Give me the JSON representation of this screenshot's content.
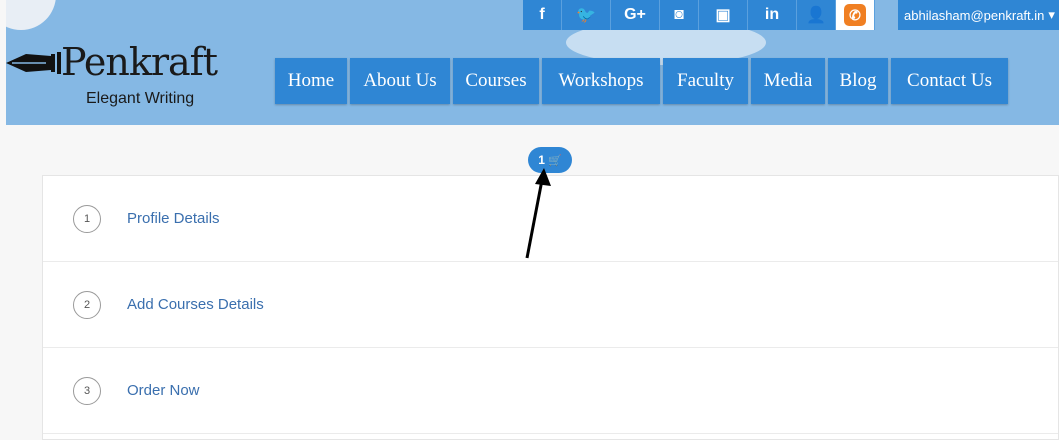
{
  "brand": {
    "name": "Penkraft",
    "tagline": "Elegant Writing"
  },
  "social": {
    "items": [
      {
        "name": "facebook-icon",
        "glyph": "f"
      },
      {
        "name": "twitter-icon",
        "glyph": "🐦"
      },
      {
        "name": "google-plus-icon",
        "glyph": "G+"
      },
      {
        "name": "instagram-icon",
        "glyph": "◙"
      },
      {
        "name": "youtube-icon",
        "glyph": "▣"
      },
      {
        "name": "linkedin-icon",
        "glyph": "in"
      },
      {
        "name": "user-icon",
        "glyph": "👤"
      }
    ],
    "phone_glyph": "✆"
  },
  "user": {
    "email": "abhilasham@penkraft.in",
    "caret": "▾"
  },
  "nav": {
    "items": [
      "Home",
      "About Us",
      "Courses",
      "Workshops",
      "Faculty",
      "Media",
      "Blog",
      "Contact Us"
    ]
  },
  "cart": {
    "count": "1",
    "icon": "🛒"
  },
  "steps": [
    {
      "number": "1",
      "label": "Profile Details"
    },
    {
      "number": "2",
      "label": "Add Courses Details"
    },
    {
      "number": "3",
      "label": "Order Now"
    }
  ],
  "colors": {
    "header_bg": "#85b8e4",
    "nav_bg": "#2f86d4",
    "step_label": "#3a6fae",
    "phone": "#f07f22"
  }
}
